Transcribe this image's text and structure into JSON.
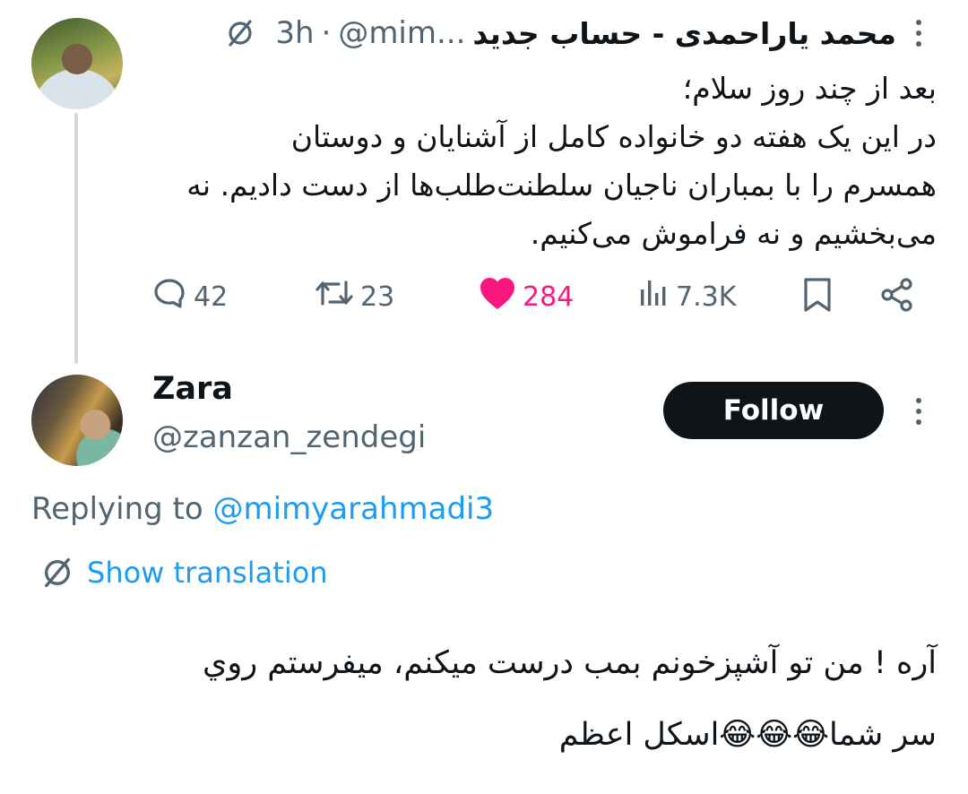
{
  "parent_tweet": {
    "display_name": "محمد یاراحمدی - حساب جدید",
    "handle": "@mim...",
    "separator": "·",
    "time": "3h",
    "text": "بعد از چند روز سلام؛\nدر این یک هفته دو خانواده کامل از آشنایان و دوستان\nهمسرم را با بمباران ناجیان سلطنت‌طلب‌ها از دست دادیم. نه\nمی‌بخشیم و نه فراموش می‌کنیم.",
    "stats": {
      "replies": "42",
      "reposts": "23",
      "likes": "284",
      "views": "7.3K"
    }
  },
  "reply_tweet": {
    "display_name": "Zara",
    "handle": "@zanzan_zendegi",
    "follow_label": "Follow",
    "replying_prefix": "Replying to",
    "replying_to": "@mimyarahmadi3",
    "show_translation": "Show translation",
    "text": "آره ! من تو آشپزخونم بمب درست میکنم، میفرستم روي\nسر شما😂😂😂اسکل اعظم"
  },
  "colors": {
    "text_primary": "#0f1419",
    "text_secondary": "#536471",
    "link": "#1d9bf0",
    "like": "#f91880",
    "button_bg": "#0f1419",
    "thread_line": "#cfd9de"
  },
  "icons": {
    "translate": "translate-icon",
    "more": "more-icon",
    "reply": "reply-icon",
    "repost": "repost-icon",
    "like": "heart-icon",
    "views": "views-icon",
    "bookmark": "bookmark-icon",
    "share": "share-icon"
  }
}
